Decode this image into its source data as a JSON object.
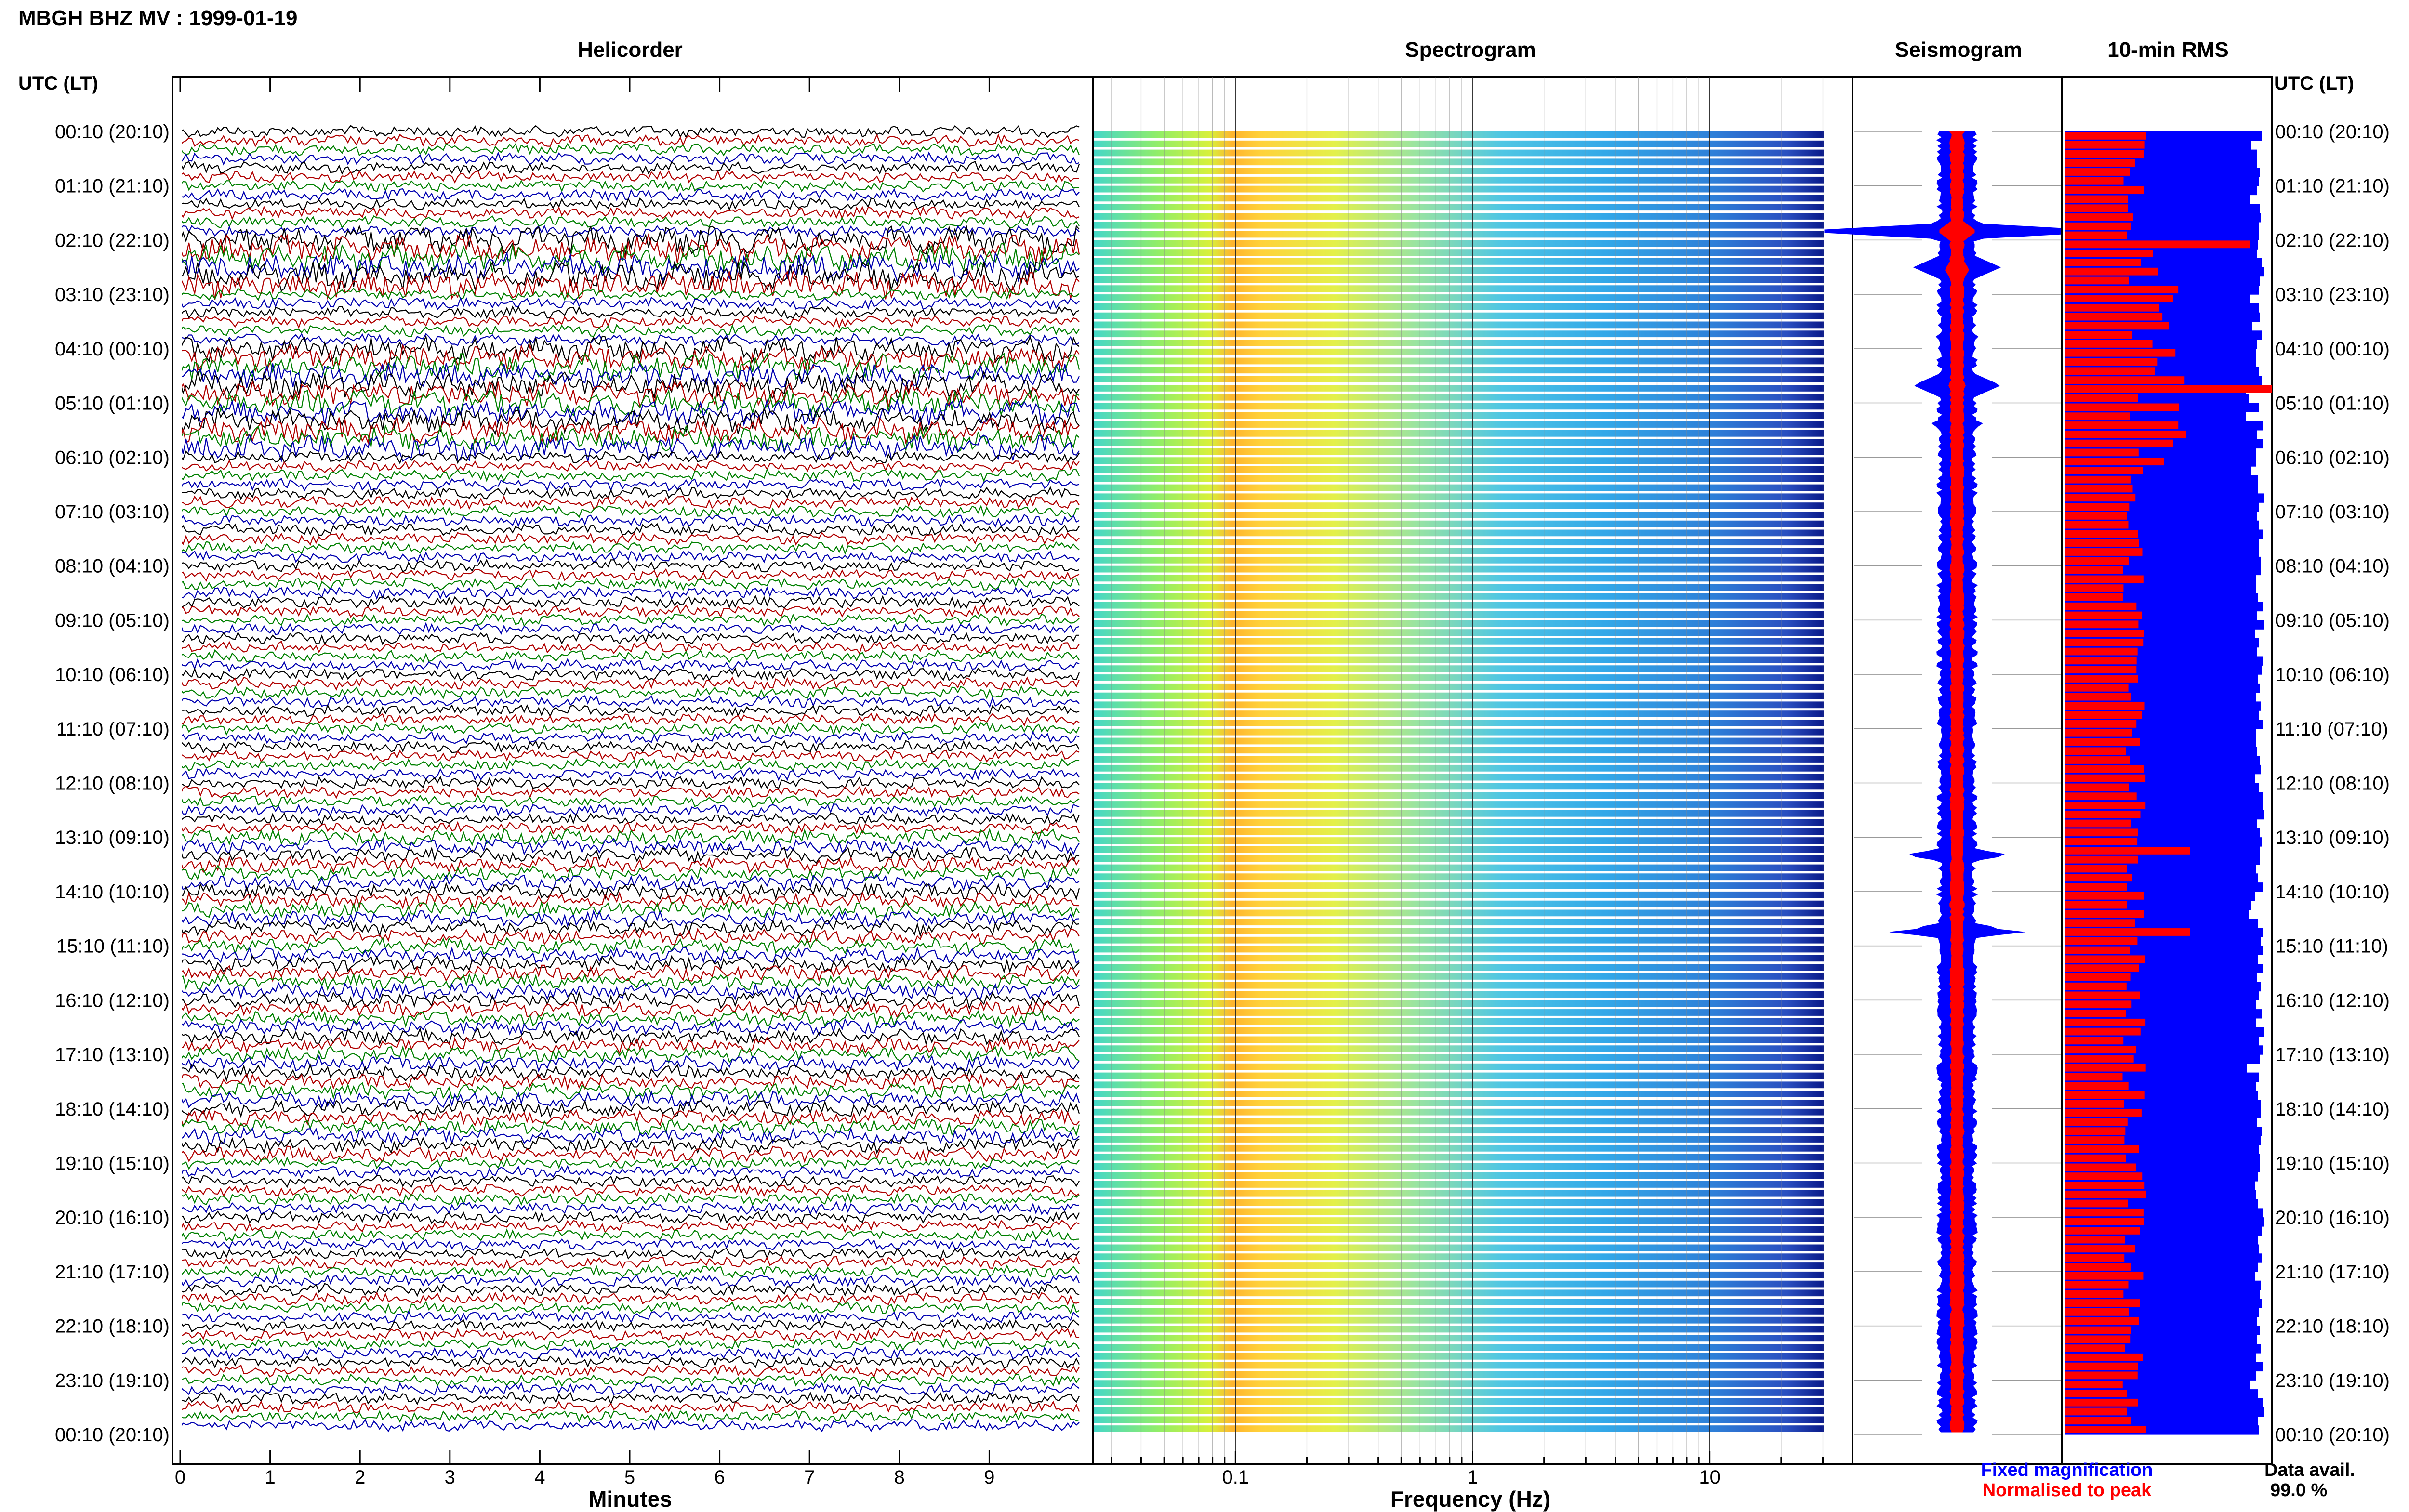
{
  "title": "MBGH BHZ MV : 1999-01-19",
  "time_axis_label": "UTC (LT)",
  "rows": [
    "00:10 (20:10)",
    "01:10 (21:10)",
    "02:10 (22:10)",
    "03:10 (23:10)",
    "04:10 (00:10)",
    "05:10 (01:10)",
    "06:10 (02:10)",
    "07:10 (03:10)",
    "08:10 (04:10)",
    "09:10 (05:10)",
    "10:10 (06:10)",
    "11:10 (07:10)",
    "12:10 (08:10)",
    "13:10 (09:10)",
    "14:10 (10:10)",
    "15:10 (11:10)",
    "16:10 (12:10)",
    "17:10 (13:10)",
    "18:10 (14:10)",
    "19:10 (15:10)",
    "20:10 (16:10)",
    "21:10 (17:10)",
    "22:10 (18:10)",
    "23:10 (19:10)",
    "00:10 (20:10)"
  ],
  "chart_data": [
    {
      "type": "line",
      "panel": "helicorder",
      "title": "Helicorder",
      "xlabel": "Minutes",
      "ylabel": "UTC (LT)",
      "xlim": [
        0,
        10
      ],
      "x_ticks": [
        "0",
        "1",
        "2",
        "3",
        "4",
        "5",
        "6",
        "7",
        "8",
        "9"
      ],
      "trace_colors": [
        "#000000",
        "#b00000",
        "#008000",
        "#0000b0"
      ],
      "traces_per_hour": 6
    },
    {
      "type": "heatmap",
      "panel": "spectrogram",
      "title": "Spectrogram",
      "xlabel": "Frequency (Hz)",
      "x_scale": "log",
      "xlim": [
        0.025,
        40
      ],
      "x_ticks": [
        "0.1",
        "1",
        "10"
      ],
      "colormap": "jet"
    },
    {
      "type": "line",
      "panel": "seismogram",
      "title": "Seismogram",
      "series": [
        {
          "name": "Fixed magnification",
          "color": "#0000ff"
        },
        {
          "name": "Normalised to peak",
          "color": "#ff0000"
        }
      ]
    },
    {
      "type": "bar",
      "panel": "rms",
      "title": "10-min RMS",
      "orientation": "horizontal",
      "series_colors": [
        "#0000ff",
        "#ff0000"
      ]
    }
  ],
  "legend": {
    "fixed": "Fixed magnification",
    "normalised": "Normalised to peak",
    "fixed_color": "#0000ff",
    "normalised_color": "#ff0000"
  },
  "data_availability": {
    "label": "Data avail.",
    "value": "99.0 %"
  }
}
